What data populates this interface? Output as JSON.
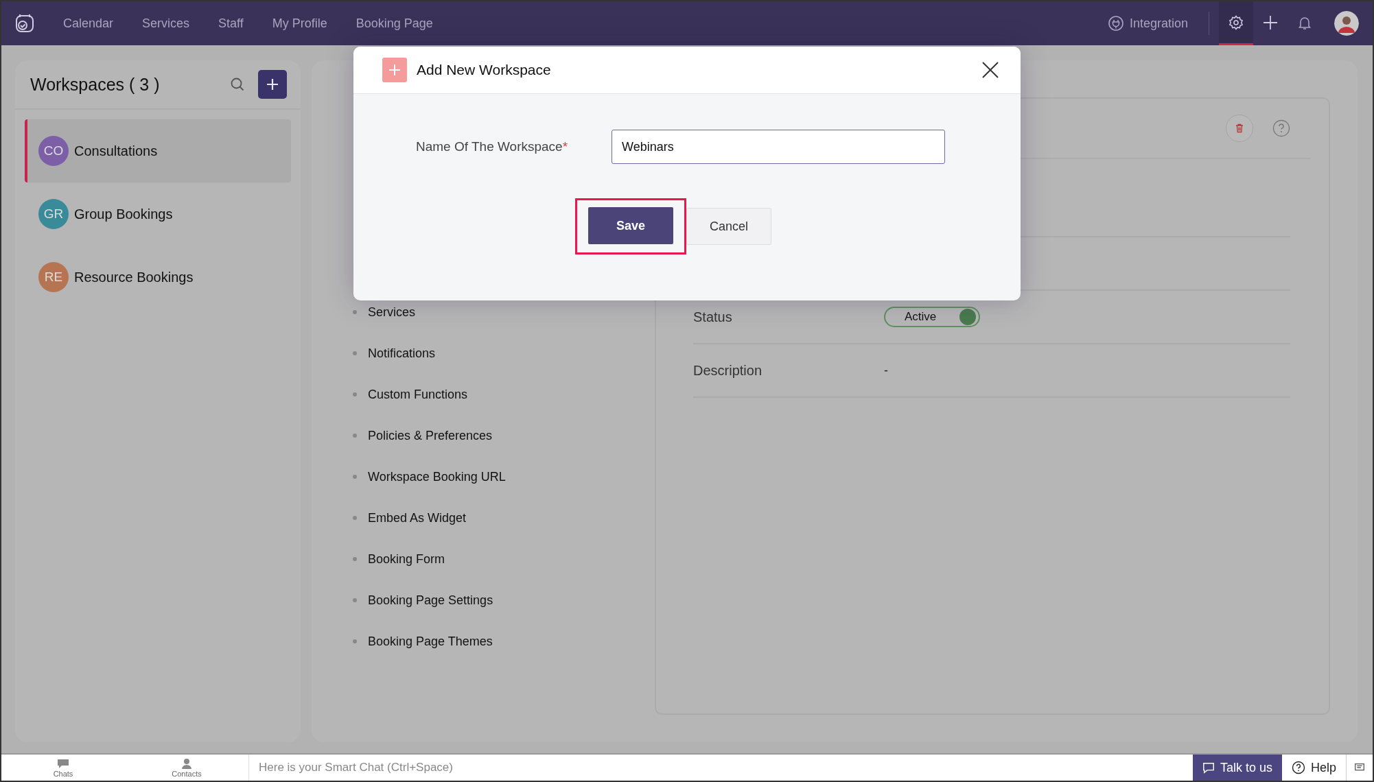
{
  "top_nav": {
    "items": [
      "Calendar",
      "Services",
      "Staff",
      "My Profile",
      "Booking Page"
    ],
    "integration": "Integration",
    "toolbar_icons": [
      {
        "kind": "gear",
        "selected": true
      },
      {
        "kind": "plus",
        "selected": false
      },
      {
        "kind": "bell",
        "selected": false
      }
    ]
  },
  "sidebar": {
    "title": "Workspaces ( 3 )",
    "items": [
      {
        "initials": "CO",
        "name": "Consultations",
        "color": "#7d5fa8",
        "selected": true
      },
      {
        "initials": "GR",
        "name": "Group Bookings",
        "color": "#3a8b99",
        "selected": false
      },
      {
        "initials": "RE",
        "name": "Resource Bookings",
        "color": "#b57553",
        "selected": false
      }
    ]
  },
  "settings_menu": [
    "Services",
    "Notifications",
    "Custom Functions",
    "Policies & Preferences",
    "Workspace Booking URL",
    "Embed As Widget",
    "Booking Form",
    "Booking Page Settings",
    "Booking Page Themes"
  ],
  "details": {
    "rows": [
      {
        "kind": "toggle",
        "label": "Status",
        "value": "Active",
        "on": true
      },
      {
        "kind": "text",
        "label": "Description",
        "value": "-"
      }
    ]
  },
  "modal": {
    "title": "Add New Workspace",
    "field_label": "Name Of The Workspace",
    "required_mark": "*",
    "value": "Webinars",
    "save": "Save",
    "save_highlighted": true,
    "cancel": "Cancel"
  },
  "bottom_bar": {
    "chats": "Chats",
    "contacts": "Contacts",
    "placeholder": "Here is your Smart Chat (Ctrl+Space)",
    "talk": "Talk to us",
    "help": "Help"
  }
}
